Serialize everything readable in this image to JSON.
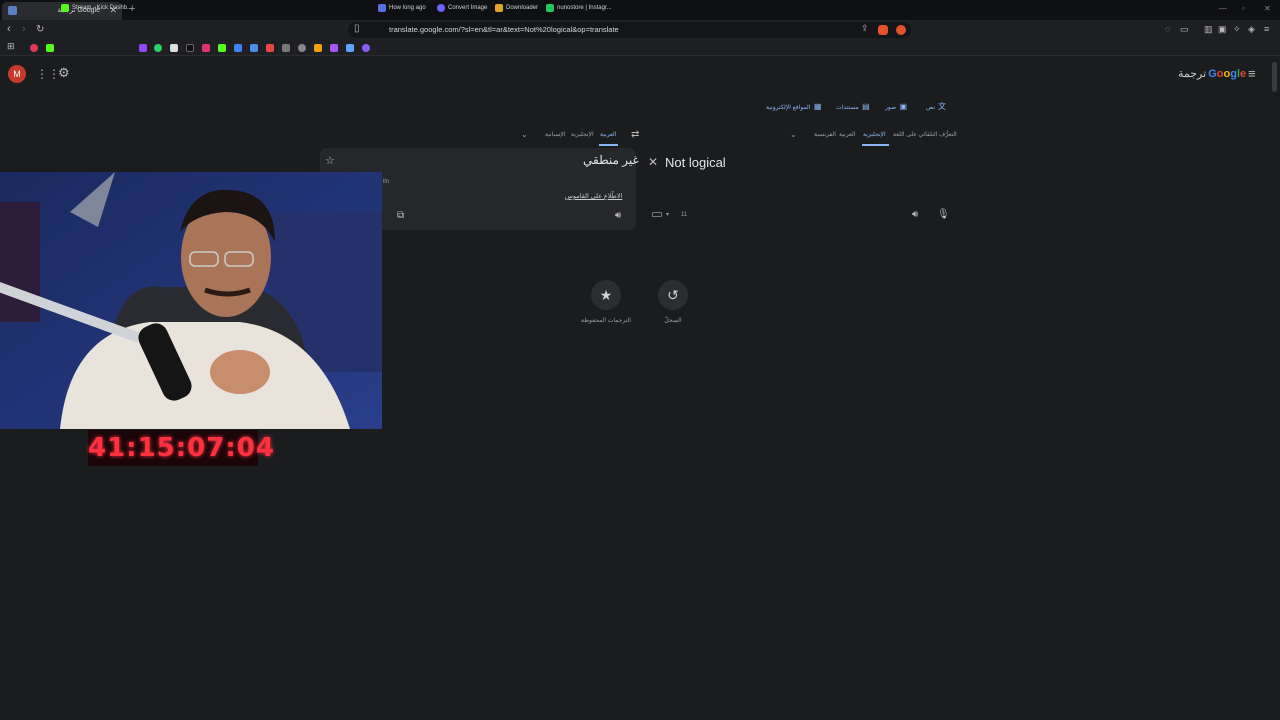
{
  "browser": {
    "tab_title": "Google ترجمة",
    "url": "translate.google.com/?sl=en&tl=ar&text=Not%20logical&op=translate",
    "bookmarks": [
      {
        "label": "Stream - Kick Dashb...",
        "color": "#53fc18"
      },
      {
        "label": "How long ago",
        "color": "#5b6ee1"
      },
      {
        "label": "Convert Image",
        "color": "#6c63ff"
      },
      {
        "label": "Downloader",
        "color": "#e0a52a"
      },
      {
        "label": "nunostore | Instagr...",
        "color": "#22c55e"
      }
    ]
  },
  "app": {
    "avatar_letter": "M",
    "logo_google": "Google",
    "logo_suffix": "ترجمة"
  },
  "modes": {
    "text": "نص",
    "images": "صور",
    "documents": "مستندات",
    "websites": "المواقع الإلكترونية"
  },
  "source_langs": {
    "detect": "التعرُّف التلقائي على اللغة",
    "english": "الإنجليزية",
    "arabic": "العربية",
    "french": "الفرنسية"
  },
  "target_langs": {
    "arabic": "العربية",
    "english": "الإنجليزية",
    "spanish": "الإسبانية"
  },
  "source": {
    "text": "Not logical",
    "count": "11"
  },
  "target": {
    "text": "غير منطقي",
    "dict_link": "الاطّلاع على القاموس",
    "fragment": "lln"
  },
  "actions": {
    "history": "السجلّ",
    "saved": "الترجمات المحفوظة"
  },
  "overlay": {
    "timer": "41:15:07:04"
  },
  "colors": {
    "accent": "#8ab4f8",
    "background": "#1b1c1e",
    "timer": "#ff3140"
  }
}
